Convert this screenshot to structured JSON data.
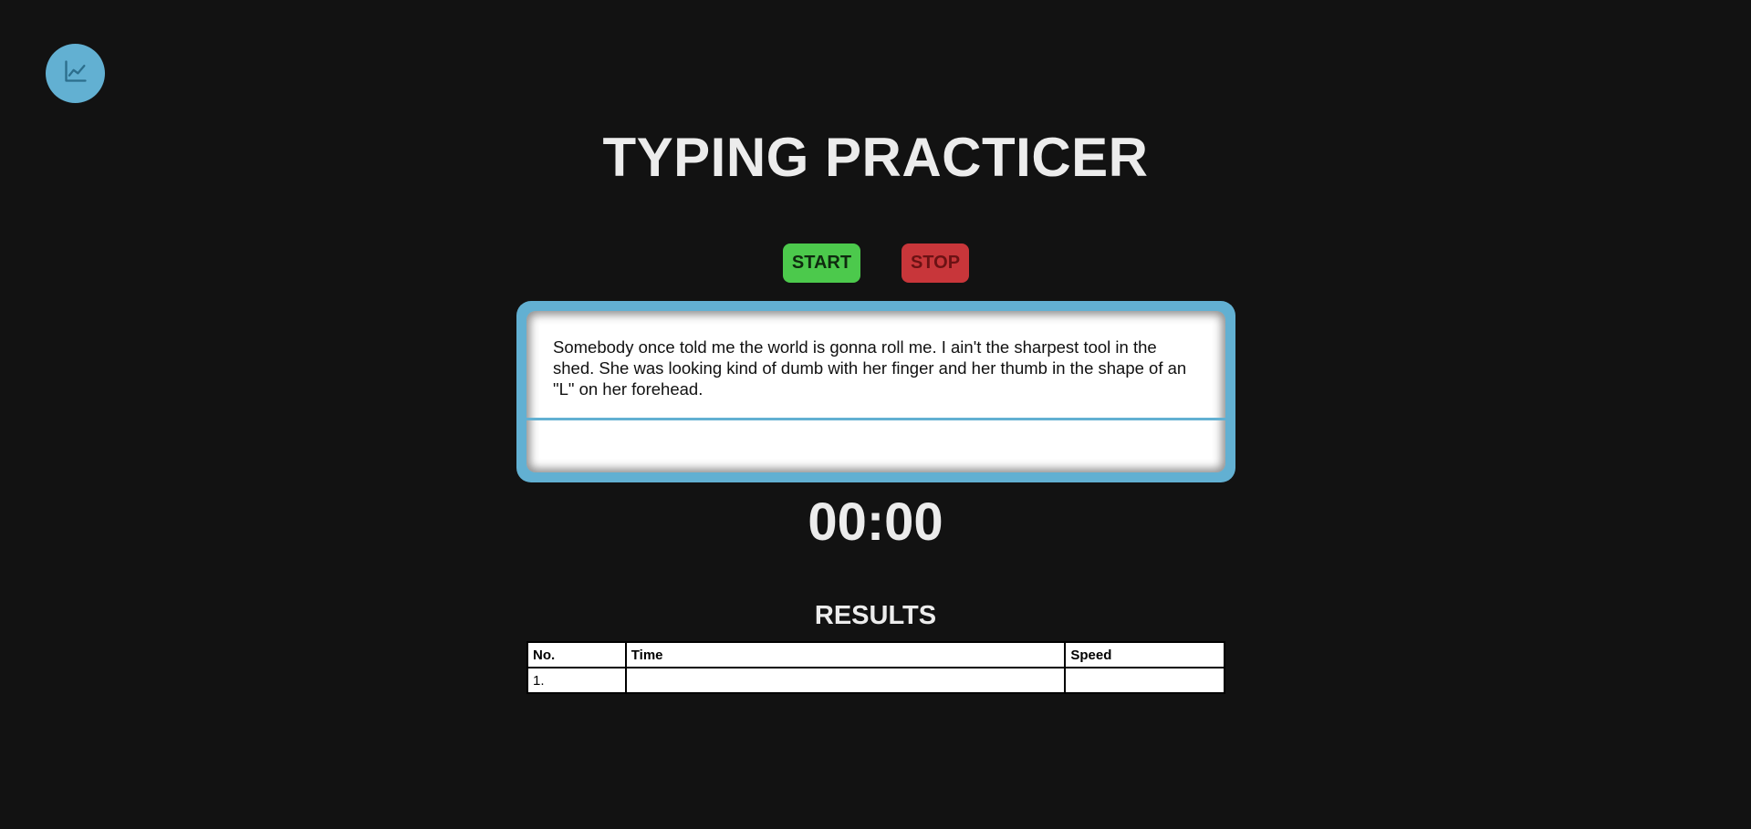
{
  "header": {
    "stats_icon": "chart-line-icon",
    "title": "TYPING PRACTICER"
  },
  "controls": {
    "start_label": "START",
    "stop_label": "STOP"
  },
  "practice": {
    "quote": "Somebody once told me the world is gonna roll me. I ain't the sharpest tool in the shed. She was looking kind of dumb with her finger and her thumb in the shape of an \"L\" on her forehead.",
    "input_value": ""
  },
  "timer": {
    "display": "00:00"
  },
  "results": {
    "title": "RESULTS",
    "columns": [
      "No.",
      "Time",
      "Speed"
    ],
    "rows": [
      [
        "1.",
        "",
        ""
      ]
    ]
  },
  "colors": {
    "accent": "#62b0d2",
    "start": "#4cc94c",
    "stop": "#c8363a",
    "background": "#121212"
  }
}
